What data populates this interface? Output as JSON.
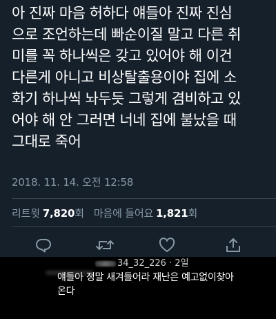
{
  "tweet": {
    "lines": [
      "아 진짜 마음 허하다 얘들아 진짜 진심",
      "으로 조언하는데 빠순이질 말고 다른 취",
      "미를 꼭 하나씩은 갖고 있어야 해 이건",
      "다른게 아니고 비상탈출용이야 집에 소",
      "화기 하나씩 놔두듯 그렇게 겸비하고 있",
      "어야 해 안 그러면 너네 집에 불났을 때",
      "그대로 죽어"
    ],
    "timestamp": "2018. 11. 14. 오전 12:58"
  },
  "stats": {
    "retweets_label": "리트윗",
    "retweets_count": "7,820",
    "retweets_suffix": "회",
    "likes_label": "마음에 들어요",
    "likes_count": "1,821",
    "likes_suffix": "회"
  },
  "actions": {
    "reply_icon": "reply-icon",
    "retweet_icon": "retweet-icon",
    "like_icon": "heart-icon",
    "share_icon": "share-icon"
  },
  "comment": {
    "meta": "34_32_226 · 2일",
    "lines": [
      "얘들아 정말 새겨들어라 재난은 예고없이찾아",
      "온다"
    ]
  },
  "colors": {
    "tweet_bg": "#15202b",
    "text": "#ffffff",
    "muted": "#8899a6",
    "divider": "#38444d",
    "comment_bg": "#000000"
  }
}
